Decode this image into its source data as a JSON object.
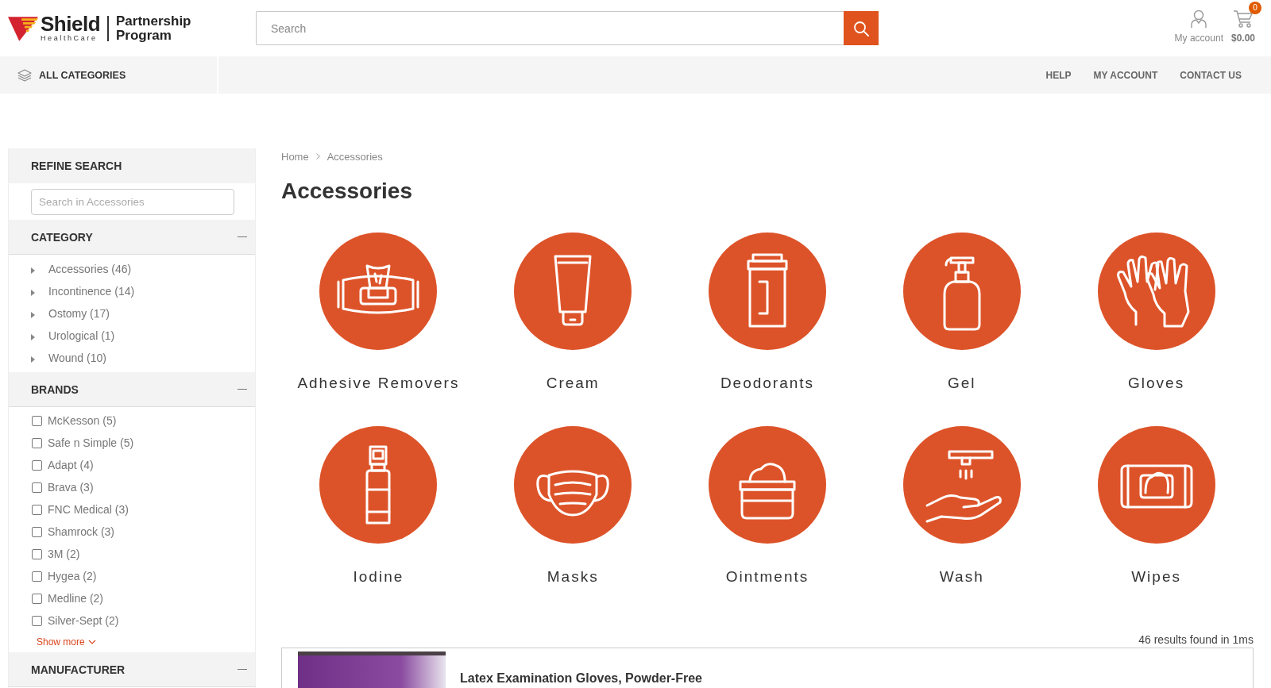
{
  "header": {
    "logo": {
      "name": "Shield",
      "tagline": "HealthCare",
      "program": "Partnership Program"
    },
    "search": {
      "placeholder": "Search"
    },
    "account": {
      "label": "My account"
    },
    "cart": {
      "count": "0",
      "total": "$0.00"
    }
  },
  "nav": {
    "all_categories": "ALL CATEGORIES",
    "links": [
      {
        "label": "HELP"
      },
      {
        "label": "MY ACCOUNT"
      },
      {
        "label": "CONTACT US"
      }
    ]
  },
  "sidebar": {
    "title": "REFINE SEARCH",
    "search": {
      "placeholder": "Search in Accessories"
    },
    "sections": [
      {
        "title": "CATEGORY",
        "kind": "tree",
        "expanded": true,
        "items": [
          {
            "label": "Accessories (46)",
            "expanded": false
          },
          {
            "label": "Incontinence (14)",
            "expanded": false
          },
          {
            "label": "Ostomy (17)",
            "expanded": false
          },
          {
            "label": "Urological (1)",
            "expanded": false
          },
          {
            "label": "Wound (10)",
            "expanded": false
          }
        ]
      },
      {
        "title": "BRANDS",
        "kind": "checklist",
        "expanded": true,
        "items": [
          {
            "label": "McKesson (5)",
            "checked": false
          },
          {
            "label": "Safe n Simple (5)",
            "checked": false
          },
          {
            "label": "Adapt (4)",
            "checked": false
          },
          {
            "label": "Brava (3)",
            "checked": false
          },
          {
            "label": "FNC Medical (3)",
            "checked": false
          },
          {
            "label": "Shamrock (3)",
            "checked": false
          },
          {
            "label": "3M (2)",
            "checked": false
          },
          {
            "label": "Hygea (2)",
            "checked": false
          },
          {
            "label": "Medline (2)",
            "checked": false
          },
          {
            "label": "Silver-Sept (2)",
            "checked": false
          }
        ],
        "show_more": "Show more"
      },
      {
        "title": "MANUFACTURER",
        "expanded": true
      }
    ]
  },
  "breadcrumb": [
    {
      "label": "Home"
    },
    {
      "label": "Accessories"
    }
  ],
  "page_title": "Accessories",
  "categories": [
    {
      "label": "Adhesive Removers"
    },
    {
      "label": "Cream"
    },
    {
      "label": "Deodorants"
    },
    {
      "label": "Gel"
    },
    {
      "label": "Gloves"
    },
    {
      "label": "Iodine"
    },
    {
      "label": "Masks"
    },
    {
      "label": "Ointments"
    },
    {
      "label": "Wash"
    },
    {
      "label": "Wipes"
    }
  ],
  "results": {
    "summary": "46 results found in 1ms"
  },
  "products": [
    {
      "title": "Latex Examination Gloves, Powder-Free"
    }
  ]
}
